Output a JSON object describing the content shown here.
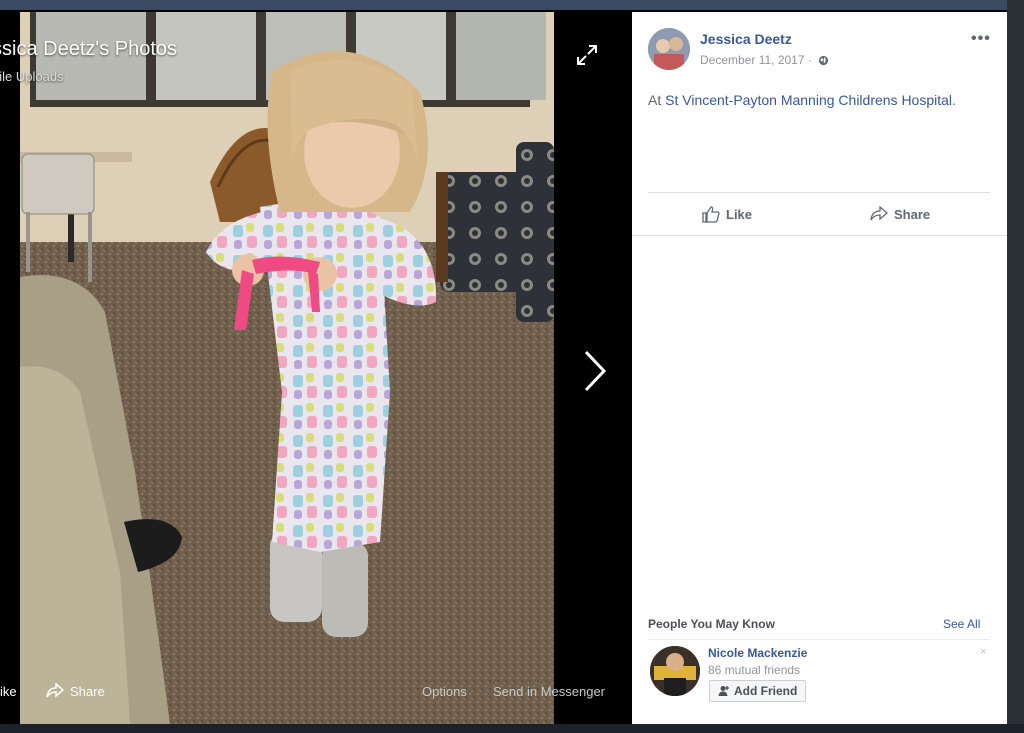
{
  "viewer": {
    "album_title": "ssica Deetz's Photos",
    "album_subtitle": "bile Uploads",
    "actions": {
      "like_label": "ike",
      "share_label": "Share",
      "options_label": "Options",
      "send_label": "Send in Messenger"
    },
    "icons": {
      "expand": "expand-icon",
      "next": "chevron-right-icon"
    }
  },
  "post": {
    "author": "Jessica Deetz",
    "date": "December 11, 2017 ·",
    "privacy_icon": "globe-icon",
    "more": "•••",
    "checkin_prefix": "At",
    "place": "St Vincent-Payton Manning Childrens Hospital",
    "checkin_suffix": ".",
    "like_label": "Like",
    "share_label": "Share"
  },
  "people_you_may_know": {
    "heading": "People You May Know",
    "see_all": "See All",
    "suggestion": {
      "name": "Nicole Mackenzie",
      "mutual": "86 mutual friends",
      "add_label": "Add Friend",
      "dismiss": "×"
    }
  },
  "colors": {
    "link": "#385898",
    "muted": "#90949c",
    "panel": "#ffffff"
  }
}
